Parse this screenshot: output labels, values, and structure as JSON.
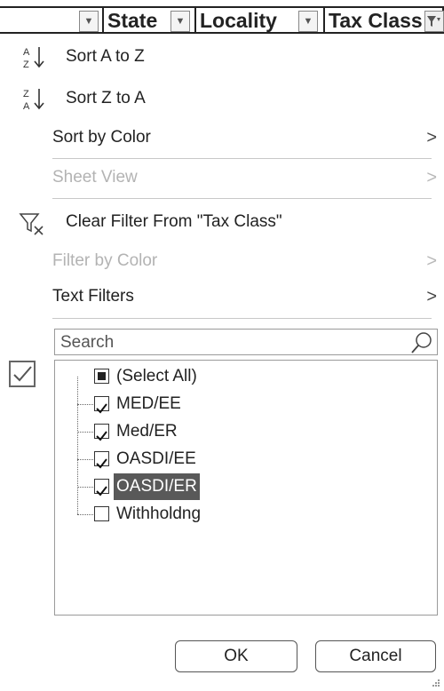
{
  "header": {
    "columns": [
      {
        "label": ""
      },
      {
        "label": "State"
      },
      {
        "label": "Locality"
      },
      {
        "label": "Tax Class"
      }
    ]
  },
  "menu": {
    "sort_asc": "Sort A to Z",
    "sort_desc": "Sort Z to A",
    "sort_by_color": "Sort by Color",
    "sheet_view": "Sheet View",
    "clear_filter": "Clear Filter From \"Tax Class\"",
    "filter_by_color": "Filter by Color",
    "text_filters": "Text Filters"
  },
  "search": {
    "placeholder": "Search"
  },
  "list": {
    "items": [
      {
        "label": "(Select All)",
        "state": "partial"
      },
      {
        "label": "MED/EE",
        "state": "checked"
      },
      {
        "label": "Med/ER",
        "state": "checked"
      },
      {
        "label": "OASDI/EE",
        "state": "checked"
      },
      {
        "label": "OASDI/ER",
        "state": "checked",
        "selected": true
      },
      {
        "label": "Withholdng",
        "state": "unchecked"
      }
    ]
  },
  "buttons": {
    "ok": "OK",
    "cancel": "Cancel"
  },
  "icons": [
    "sort-az-icon",
    "sort-za-icon",
    "chevron-right-icon",
    "clear-filter-icon",
    "search-icon",
    "dropdown-arrow-icon",
    "filter-active-icon",
    "checkbox-icon",
    "resize-grip-icon"
  ]
}
